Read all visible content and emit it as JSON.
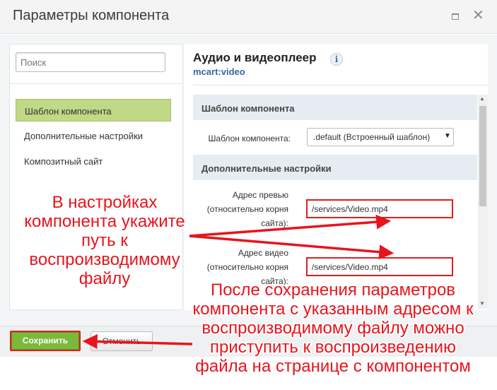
{
  "window": {
    "title": "Параметры компонента"
  },
  "sidebar": {
    "search_placeholder": "Поиск",
    "items": [
      {
        "label": "Шаблон компонента",
        "active": true
      },
      {
        "label": "Дополнительные настройки",
        "active": false
      },
      {
        "label": "Композитный сайт",
        "active": false
      }
    ]
  },
  "component": {
    "title": "Аудио и видеоплеер",
    "id": "mcart:video",
    "info_icon": "info-icon"
  },
  "sections": {
    "template": {
      "header": "Шаблон компонента",
      "field_label": "Шаблон компонента:",
      "selected": ".default (Встроенный шаблон)"
    },
    "extra": {
      "header": "Дополнительные настройки",
      "preview_label": [
        "Адрес превью",
        "(относительно корня",
        "сайта):"
      ],
      "preview_value": "/services/Video.mp4",
      "video_label": [
        "Адрес видео",
        "(относительно корня",
        "сайта):"
      ],
      "video_value": "/services/Video.mp4"
    }
  },
  "footer": {
    "save_label": "Сохранить",
    "cancel_label": "Отменить"
  },
  "annotations": {
    "left_note": [
      "В настройках",
      "компонента укажите",
      "путь к",
      "воспроизводимому",
      "файлу"
    ],
    "bottom_note": [
      "После сохранения параметров",
      "компонента с указанным адресом к",
      "воспроизводимому файлу можно",
      "приступить к воспроизведению",
      "файла на странице с компонентом"
    ]
  },
  "colors": {
    "annotation": "#e8141c",
    "save_button": "#7ab93a",
    "active_nav": "#bfd986",
    "link": "#3568a3"
  }
}
